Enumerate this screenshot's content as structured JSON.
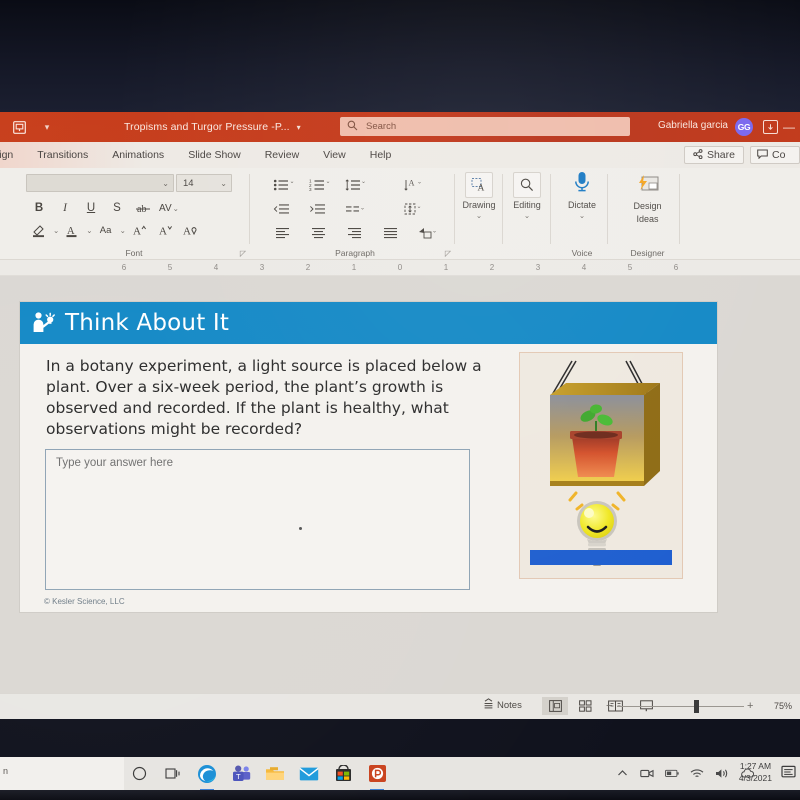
{
  "window": {
    "app_icon": "powerpoint-icon",
    "quick_access_caret": "▾",
    "title": "Tropisms and Turgor Pressure -P...",
    "title_caret": "▾",
    "search_placeholder": "Search",
    "user_name": "Gabriella garcia",
    "avatar_initials": "GG",
    "minimize_label": "—",
    "accent_color": "#c43e1c"
  },
  "tabs": [
    {
      "label": "sign",
      "clipped": true
    },
    {
      "label": "Transitions"
    },
    {
      "label": "Animations"
    },
    {
      "label": "Slide Show"
    },
    {
      "label": "Review"
    },
    {
      "label": "View"
    },
    {
      "label": "Help"
    }
  ],
  "tab_actions": {
    "share_label": "Share",
    "comments_label": "Co"
  },
  "ribbon": {
    "font_group": {
      "label": "Font",
      "font_name_value": "",
      "font_size_value": "14",
      "buttons": [
        "B",
        "I",
        "U",
        "S",
        "abc-strikethrough",
        "AV"
      ],
      "buttons_row2": [
        "text-highlight",
        "font-color",
        "Aa",
        "A˄",
        "A˅",
        "clear-formatting"
      ]
    },
    "paragraph_group": {
      "label": "Paragraph",
      "row1": [
        "bullets",
        "numbering",
        "line-spacing",
        "text-direction"
      ],
      "row2": [
        "decrease-indent",
        "increase-indent",
        "columns",
        "align-text"
      ],
      "row3": [
        "align-left",
        "align-center",
        "align-right",
        "justify",
        "convert-to-smartart"
      ]
    },
    "drawing_group": {
      "label": "Drawing",
      "caret": "⌄"
    },
    "editing_group": {
      "label": "Editing",
      "caret": "⌄"
    },
    "voice_group": {
      "label": "Voice",
      "button_label": "Dictate",
      "caret": "⌄"
    },
    "designer_group": {
      "label": "Designer",
      "button_label_line1": "Design",
      "button_label_line2": "Ideas"
    }
  },
  "ruler": {
    "ticks": [
      "6",
      "5",
      "4",
      "3",
      "2",
      "1",
      "0",
      "1",
      "2",
      "3",
      "4",
      "5",
      "6"
    ]
  },
  "slide": {
    "header_title": "Think About It",
    "header_color": "#1489c6",
    "header_icon": "person-with-idea-icon",
    "question": "In a botany experiment, a light source is placed below a plant. Over a six-week period, the plant’s growth is observed and recorded. If the plant is healthy, what observations might be recorded?",
    "answer_placeholder": "Type your answer here",
    "copyright": "© Kesler Science, LLC",
    "illustration": {
      "name": "plant-in-box-with-lightbulb-below",
      "box_color": "#b5891f",
      "pot_color": "#e0502a",
      "bulb_color": "#f2e820",
      "ground_color": "#1f5fd0"
    }
  },
  "status_bar": {
    "notes_label": "Notes",
    "views": [
      "normal-view",
      "slide-sorter-view",
      "reading-view",
      "slide-show-view"
    ],
    "zoom_minus": "−",
    "zoom_plus": "+",
    "zoom_value": "75%"
  },
  "taskbar": {
    "left_text": "n",
    "icons": [
      {
        "name": "cortana-icon"
      },
      {
        "name": "task-view-icon"
      },
      {
        "name": "edge-icon"
      },
      {
        "name": "teams-icon"
      },
      {
        "name": "file-explorer-icon"
      },
      {
        "name": "mail-icon"
      },
      {
        "name": "microsoft-store-icon"
      },
      {
        "name": "powerpoint-taskbar-icon"
      }
    ],
    "tray": [
      "show-hidden-icons",
      "meet-now-icon",
      "battery-icon",
      "wifi-icon",
      "volume-icon",
      "onedrive-icon"
    ],
    "time": "1:27 AM",
    "date": "4/3/2021",
    "notification_icon": "action-center-icon"
  }
}
